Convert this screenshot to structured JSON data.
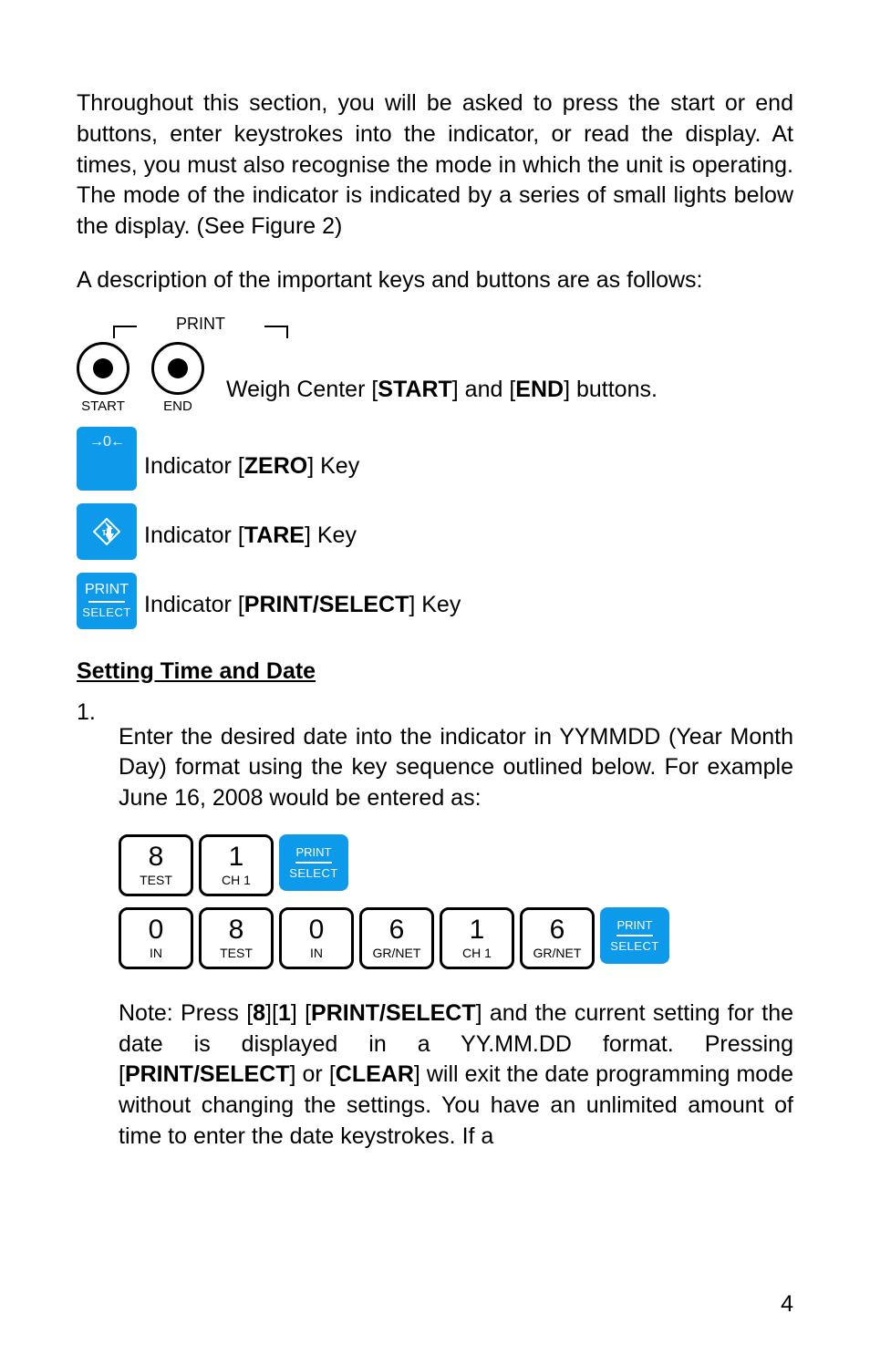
{
  "intro_para": "Throughout this section, you will be asked to press the start or end buttons, enter keystrokes into the indicator, or read the display. At times, you must also recognise the mode in which the unit is operating. The mode of the indicator is indicated by a series of small lights below the display. (See Figure 2)",
  "desc_para": "A description of the important keys and buttons are as follows:",
  "print_bracket_label": "PRINT",
  "start_button_label": "START",
  "end_button_label": "END",
  "start_end_text_before": "Weigh Center [",
  "start_end_bold1": "START",
  "start_end_mid": "] and [",
  "start_end_bold2": "END",
  "start_end_after": "] buttons.",
  "zero_key_symbol": "→0←",
  "zero_text_before": "Indicator [",
  "zero_bold": "ZERO",
  "zero_after": "] Key",
  "tare_text_before": "Indicator [",
  "tare_bold": "TARE",
  "tare_after": "] Key",
  "ps_top": "PRINT",
  "ps_bottom": "SELECT",
  "ps_text_before": "Indicator [",
  "ps_bold": "PRINT/SELECT",
  "ps_after": "] Key",
  "heading": "Setting Time and Date",
  "step1_num": "1.",
  "step1_text": "Enter the desired date into the indicator in YYMMDD (Year Month Day) format using the key sequence outlined below. For example June 16, 2008 would be entered as:",
  "row1": [
    {
      "digit": "8",
      "sub": "TEST"
    },
    {
      "digit": "1",
      "sub": "CH 1"
    }
  ],
  "row2": [
    {
      "digit": "0",
      "sub": "IN"
    },
    {
      "digit": "8",
      "sub": "TEST"
    },
    {
      "digit": "0",
      "sub": "IN"
    },
    {
      "digit": "6",
      "sub": "GR/NET"
    },
    {
      "digit": "1",
      "sub": "CH 1"
    },
    {
      "digit": "6",
      "sub": "GR/NET"
    }
  ],
  "note_parts": {
    "p0": "Note: Press [",
    "b1": "8",
    "p1": "][",
    "b2": "1",
    "p2": "] [",
    "b3": "PRINT/SELECT",
    "p3": "] and the current setting for the date is displayed in a YY.MM.DD format. Pressing [",
    "b4": "PRINT/SELECT",
    "p4": "] or [",
    "b5": "CLEAR",
    "p5": "] will exit the date programming mode without changing the settings. You have an unlimited amount of time to enter the date keystrokes. If a"
  },
  "page_number": "4"
}
